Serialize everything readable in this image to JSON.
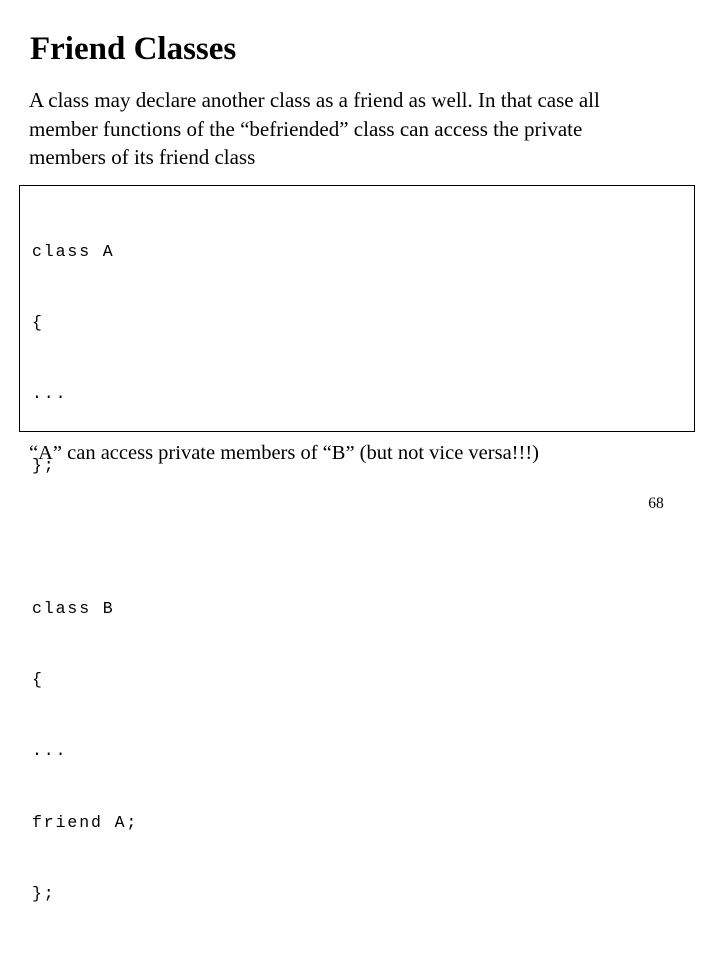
{
  "slide": {
    "title": "Friend Classes",
    "body_lines": [
      "A class may declare another class as a friend as well. In that case all",
      "member functions of the “befriended” class can access the private",
      "members of its friend class"
    ],
    "code_lines": [
      "class A",
      "{",
      "...",
      "};",
      "",
      "class B",
      "{",
      "...",
      "friend A;",
      "};"
    ],
    "caption": "“A” can access private members of “B” (but not vice versa!!!)",
    "page_number": "68"
  },
  "colors": {
    "background": "#ffffff",
    "text": "#000000",
    "border": "#000000"
  }
}
